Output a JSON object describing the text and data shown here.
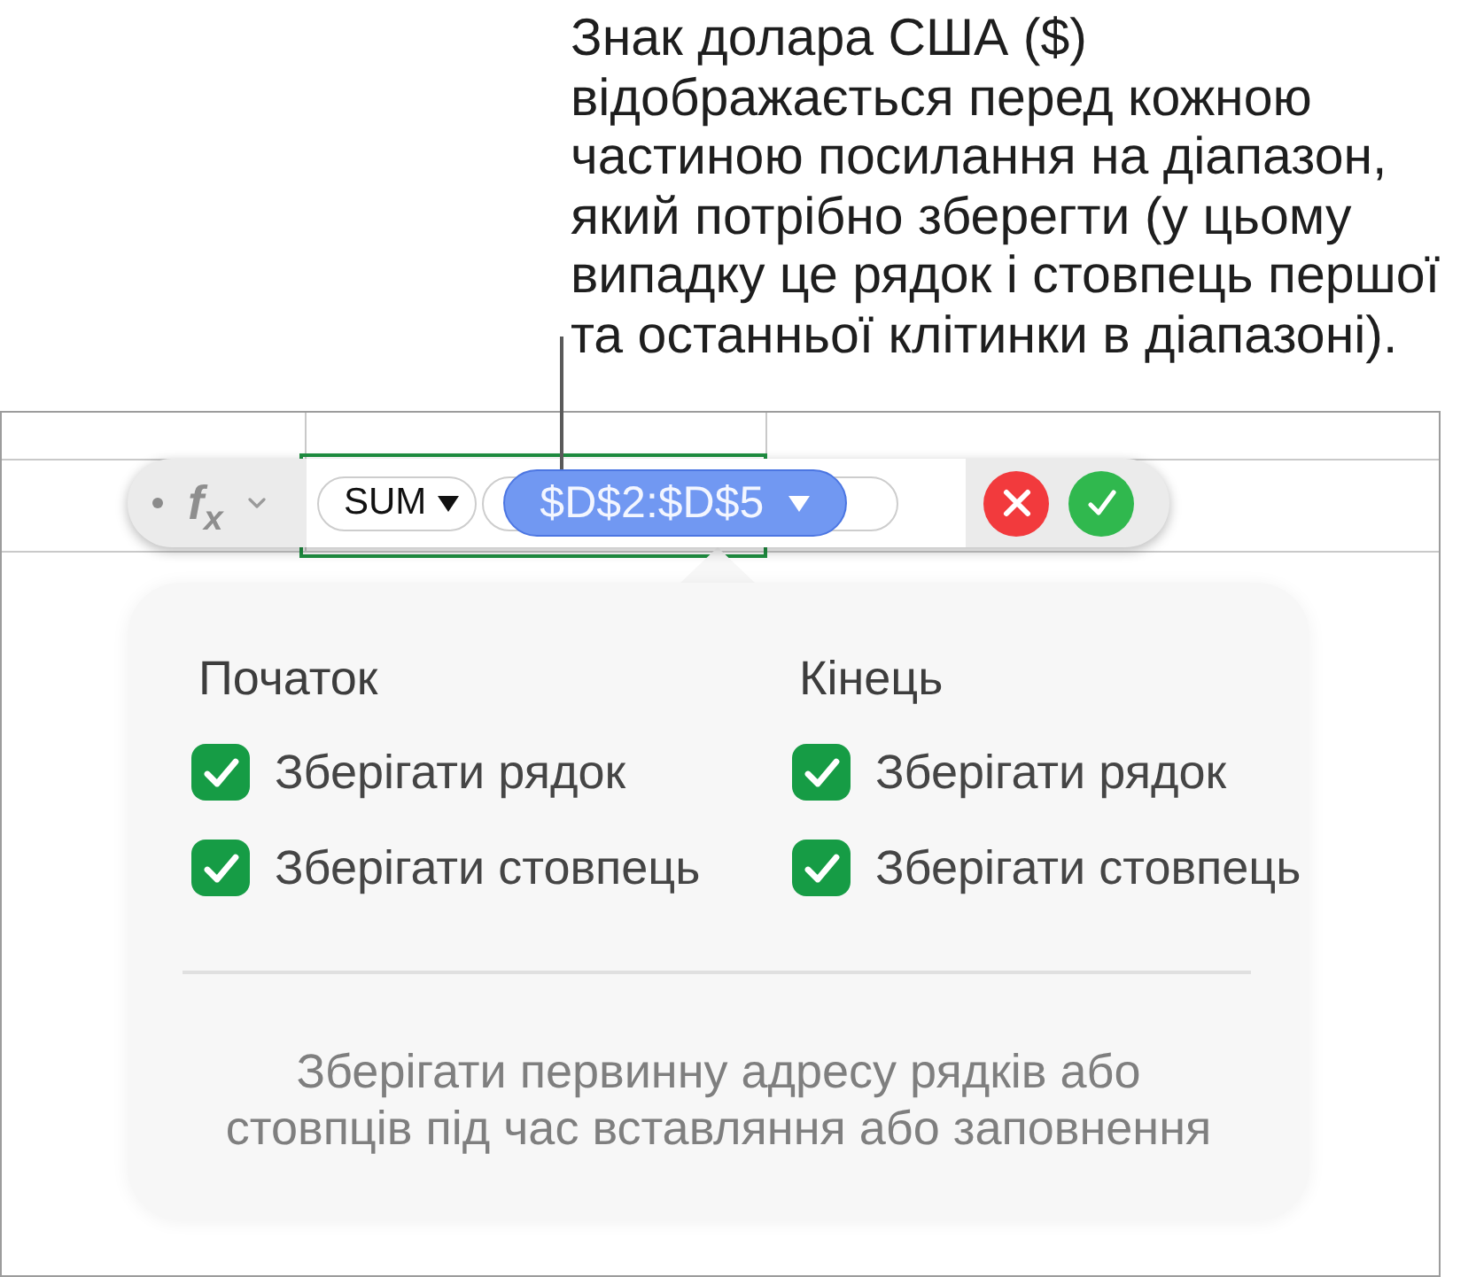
{
  "callout": {
    "lines": [
      "Знак долара США ($)",
      "відображається перед кожною",
      "частиною посилання на діапазон,",
      "який потрібно зберегти (у цьому",
      "випадку це рядок і стовпець першої",
      "та останньої клітинки в діапазоні)."
    ]
  },
  "formula_bar": {
    "function_label": "f$_{x}$",
    "tokens": [
      {
        "label": "SUM",
        "selected": false
      },
      {
        "label": "$D$2:$D$5",
        "selected": true
      }
    ]
  },
  "preserve_popover": {
    "columns": [
      {
        "heading": "Початок",
        "options": [
          {
            "label": "Зберігати рядок",
            "checked": true
          },
          {
            "label": "Зберігати стовпець",
            "checked": true
          }
        ]
      },
      {
        "heading": "Кінець",
        "options": [
          {
            "label": "Зберігати рядок",
            "checked": true
          },
          {
            "label": "Зберігати стовпець",
            "checked": true
          }
        ]
      }
    ],
    "note_lines": [
      "Зберігати первинну адресу рядків або",
      "стовпців під час вставляння або заповнення"
    ]
  }
}
